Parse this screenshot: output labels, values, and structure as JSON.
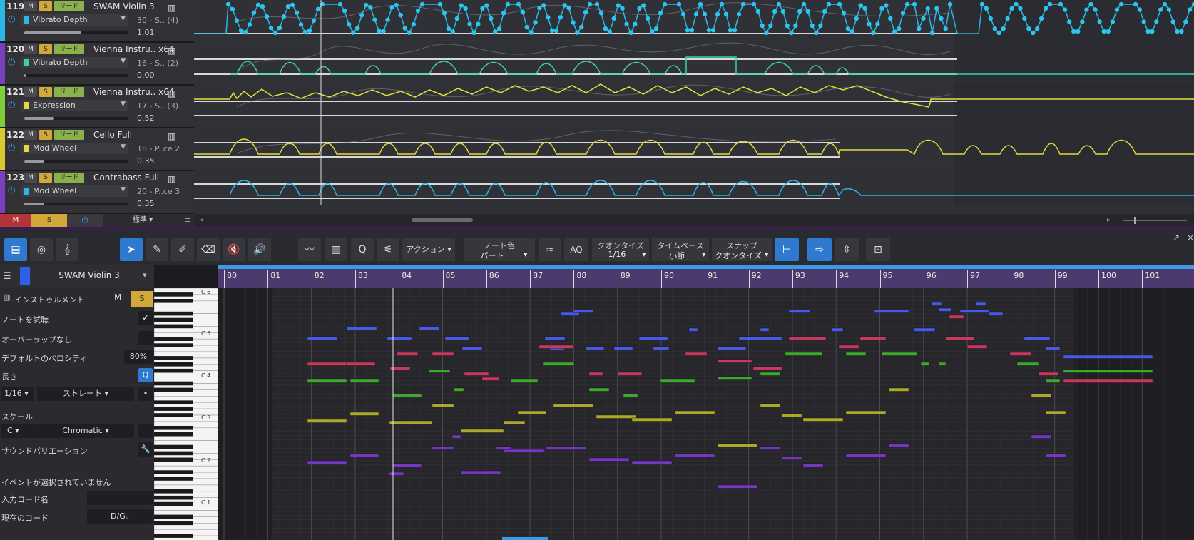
{
  "tracks": [
    {
      "num": "119",
      "name": "SWAM Violin 3",
      "param": "Vibrato Depth",
      "info": "30 - S.. (4)",
      "value": "1.01",
      "level": 1.0,
      "color": "#2bb7e6",
      "swatch": "#2bb7e6",
      "m": "M",
      "s": "S",
      "r": "リード"
    },
    {
      "num": "120",
      "name": "Vienna Instru.. x64",
      "param": "Vibrato Depth",
      "info": "16 - S.. (2)",
      "value": "0.00",
      "level": 0.0,
      "color": "#7a3fc0",
      "swatch": "#3ccfa8",
      "m": "M",
      "s": "S",
      "r": "リード"
    },
    {
      "num": "121",
      "name": "Vienna Instru.. x64",
      "param": "Expression",
      "info": "17 - S.. (3)",
      "value": "0.52",
      "level": 0.52,
      "color": "#7fcf3a",
      "swatch": "#e6d93a",
      "m": "M",
      "s": "S",
      "r": "リード"
    },
    {
      "num": "122",
      "name": "Cello Full",
      "param": "Mod Wheel",
      "info": "18 - P..ce 2",
      "value": "0.35",
      "level": 0.35,
      "color": "#d7c92e",
      "swatch": "#e6d93a",
      "m": "M",
      "s": "S",
      "r": "リード"
    },
    {
      "num": "123",
      "name": "Contrabass Full",
      "param": "Mod Wheel",
      "info": "20 - P..ce 3",
      "value": "0.35",
      "level": 0.35,
      "color": "#7a3fc0",
      "swatch": "#2bb7e6",
      "m": "M",
      "s": "S",
      "r": "リード"
    }
  ],
  "track_footer": {
    "m": "M",
    "s": "S",
    "power": "⏻",
    "standard": "標準",
    "menu": "≡"
  },
  "toolbar": {
    "action": "アクション",
    "note_color_label": "ノート色",
    "note_color_value": "パート",
    "aq": "AQ",
    "quantize_label": "クオンタイズ",
    "quantize_value": "1/16",
    "timebase_label": "タイムベース",
    "timebase_value": "小節",
    "snap_label": "スナップ",
    "snap_value": "クオンタイズ"
  },
  "inspector": {
    "instrument_name": "SWAM Violin 3",
    "instrument_label": "インストゥルメント",
    "m": "M",
    "s": "S",
    "audition_label": "ノートを試聴",
    "no_overlap_label": "オーバーラップなし",
    "default_velocity_label": "デフォルトのベロシティ",
    "default_velocity_value": "80%",
    "length_label": "長さ",
    "length_value": "1/16",
    "length_mode": "ストレート",
    "scale_label": "スケール",
    "scale_root": "C",
    "scale_type": "Chromatic",
    "sound_variation_label": "サウンドバリエーション",
    "no_events_label": "イベントが選択されていません",
    "input_chord_label": "入力コード名",
    "input_chord_value": "",
    "current_chord_label": "現在のコード",
    "current_chord_value": "D/G♭"
  },
  "keyboard": {
    "labels": [
      "C 6",
      "C 5",
      "C 4",
      "C 3",
      "C 2",
      "C 1"
    ]
  },
  "ruler": {
    "bars": [
      "80",
      "81",
      "82",
      "83",
      "84",
      "85",
      "86",
      "87",
      "88",
      "89",
      "90",
      "91",
      "92",
      "93",
      "94",
      "95",
      "96",
      "97",
      "98",
      "99",
      "100",
      "101"
    ]
  },
  "colors": {
    "accent": "#2f7ad0",
    "blue_notes": "#4a5cf0",
    "red_notes": "#d03a62",
    "green_notes": "#3fb02e",
    "yellow_notes": "#b4b02a",
    "purple_notes": "#7a38c8"
  }
}
